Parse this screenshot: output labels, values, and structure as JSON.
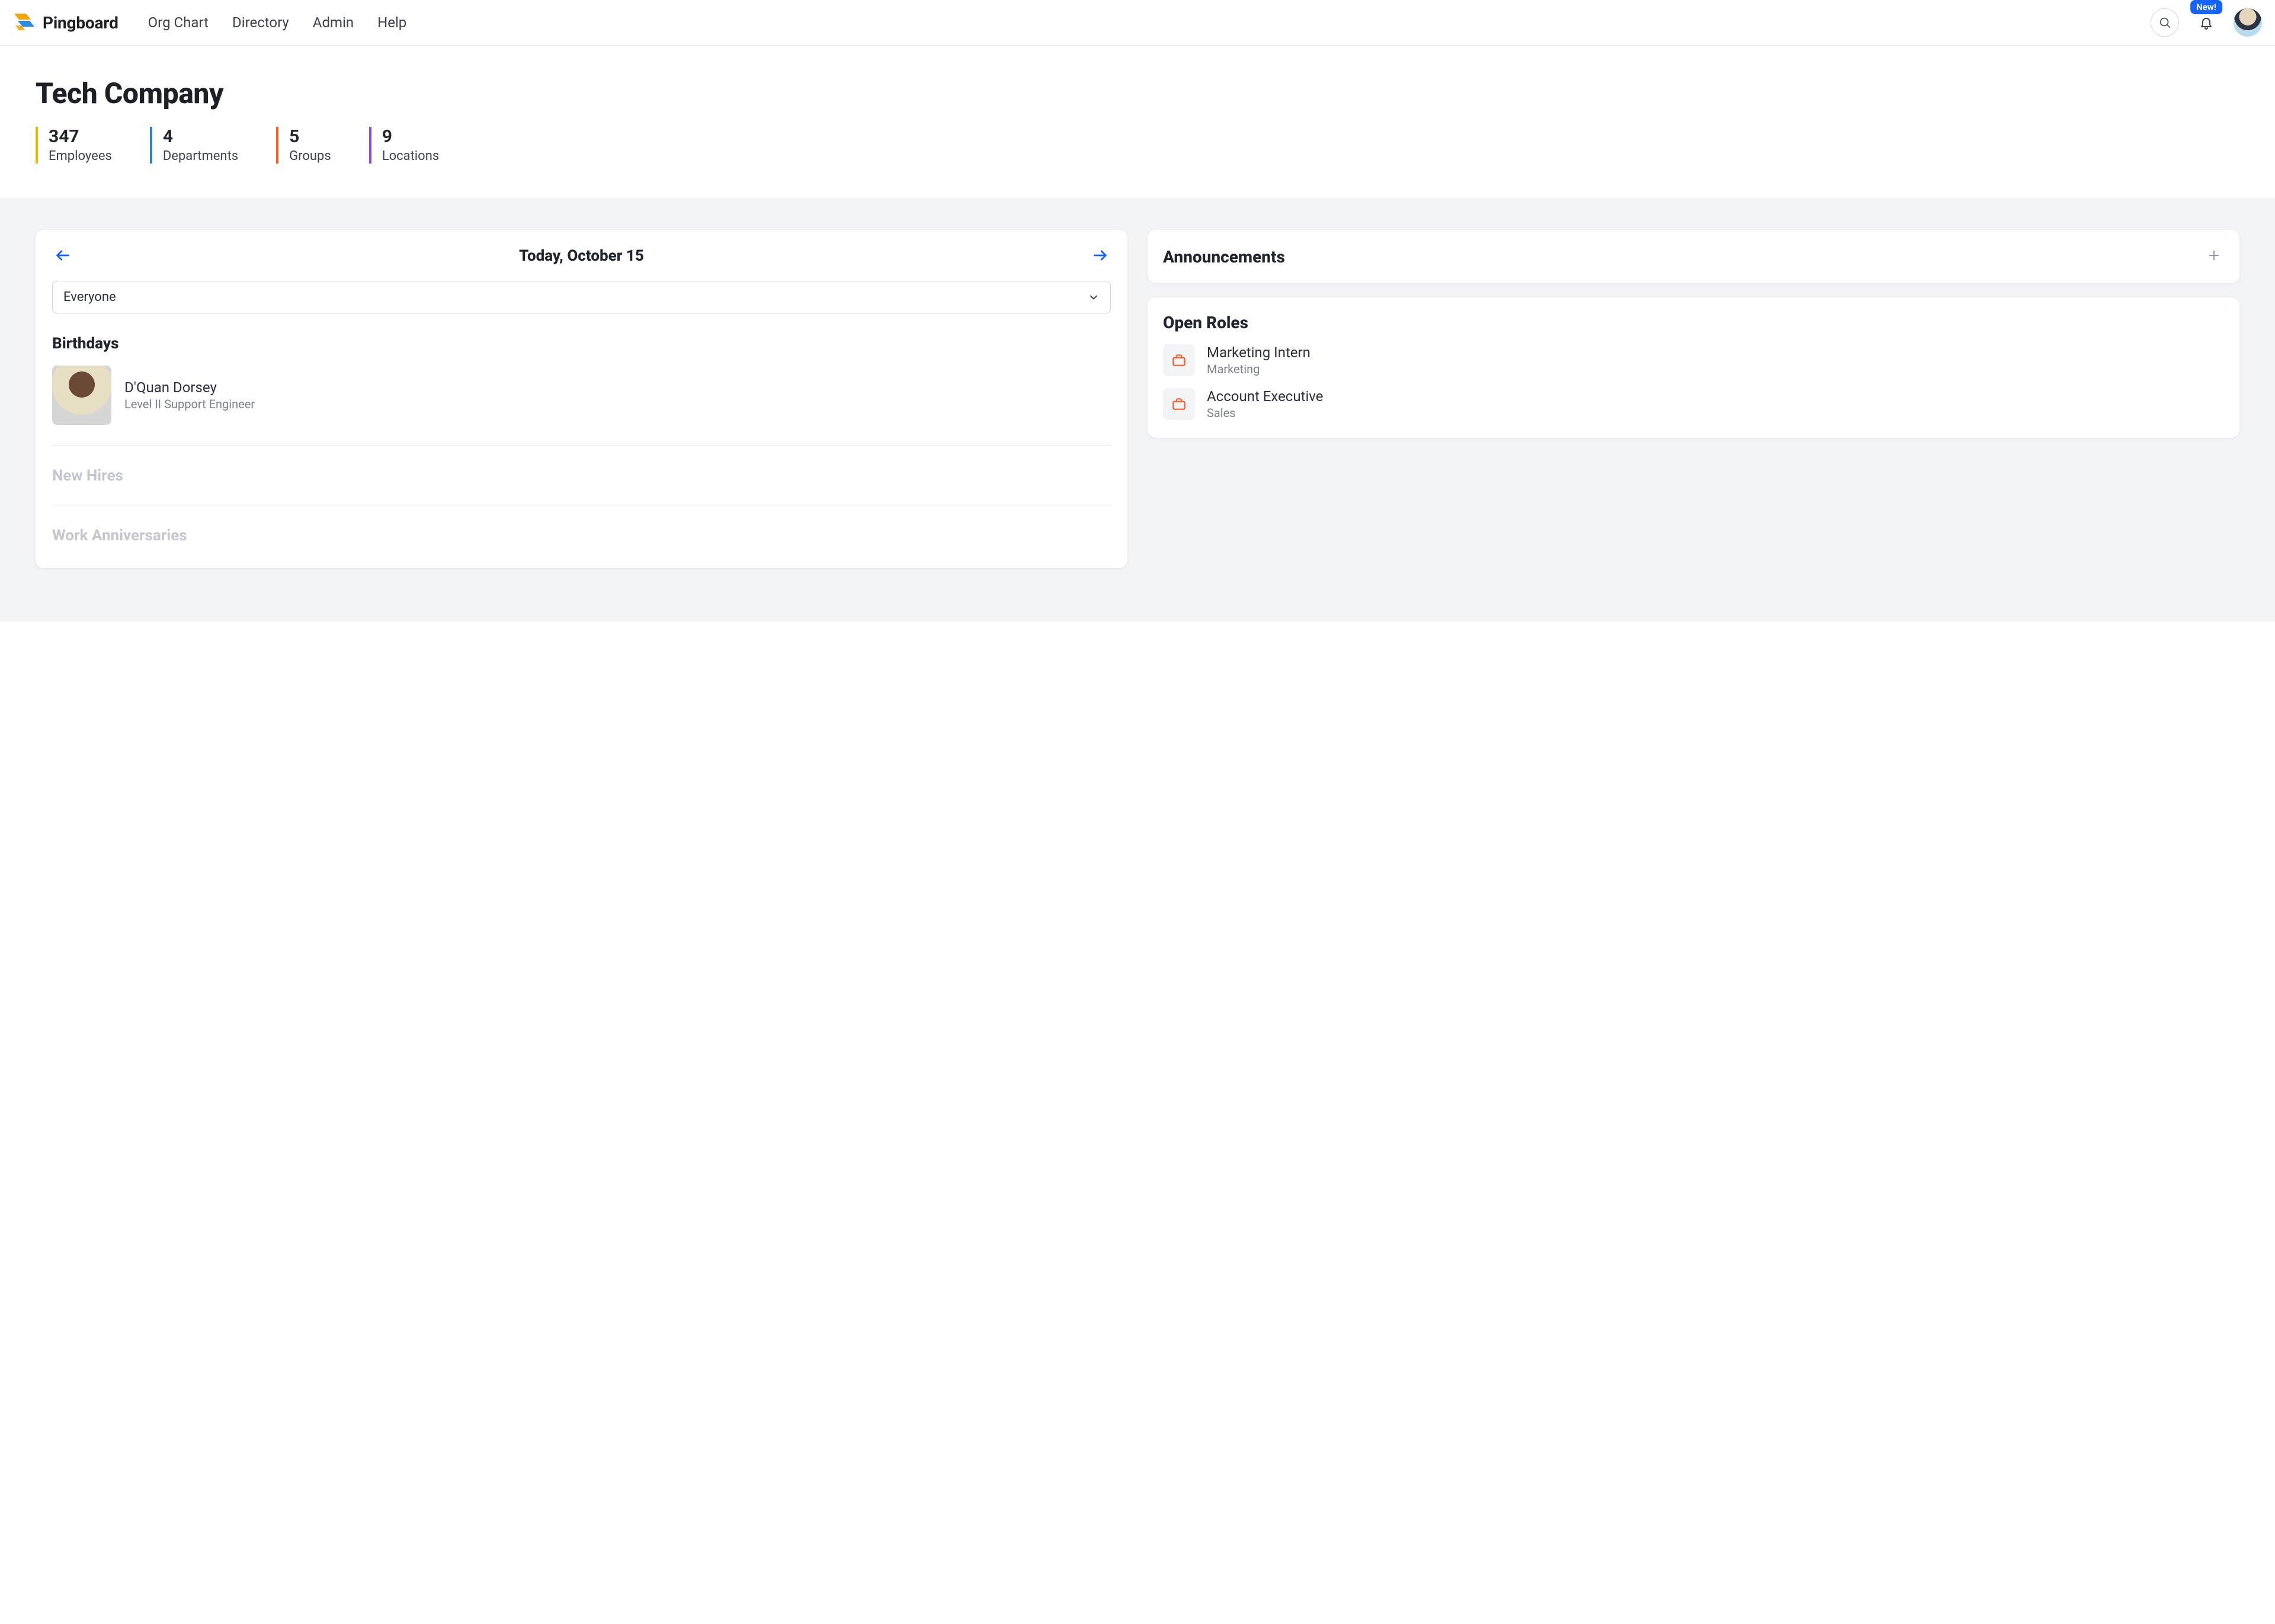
{
  "brand": {
    "name": "Pingboard"
  },
  "nav": {
    "items": [
      {
        "label": "Org Chart"
      },
      {
        "label": "Directory"
      },
      {
        "label": "Admin"
      },
      {
        "label": "Help"
      }
    ],
    "new_badge": "New!"
  },
  "header": {
    "company_name": "Tech Company",
    "stats": {
      "employees": {
        "value": "347",
        "label": "Employees"
      },
      "departments": {
        "value": "4",
        "label": "Departments"
      },
      "groups": {
        "value": "5",
        "label": "Groups"
      },
      "locations": {
        "value": "9",
        "label": "Locations"
      }
    }
  },
  "feed": {
    "date_label": "Today, October 15",
    "scope_select": {
      "value": "Everyone"
    },
    "sections": {
      "birthdays": {
        "title": "Birthdays",
        "people": [
          {
            "name": "D'Quan Dorsey",
            "role": "Level II Support Engineer"
          }
        ]
      },
      "new_hires": {
        "title": "New Hires"
      },
      "anniversaries": {
        "title": "Work Anniversaries"
      }
    }
  },
  "announcements": {
    "title": "Announcements"
  },
  "open_roles": {
    "title": "Open Roles",
    "items": [
      {
        "title": "Marketing Intern",
        "department": "Marketing"
      },
      {
        "title": "Account Executive",
        "department": "Sales"
      }
    ]
  }
}
